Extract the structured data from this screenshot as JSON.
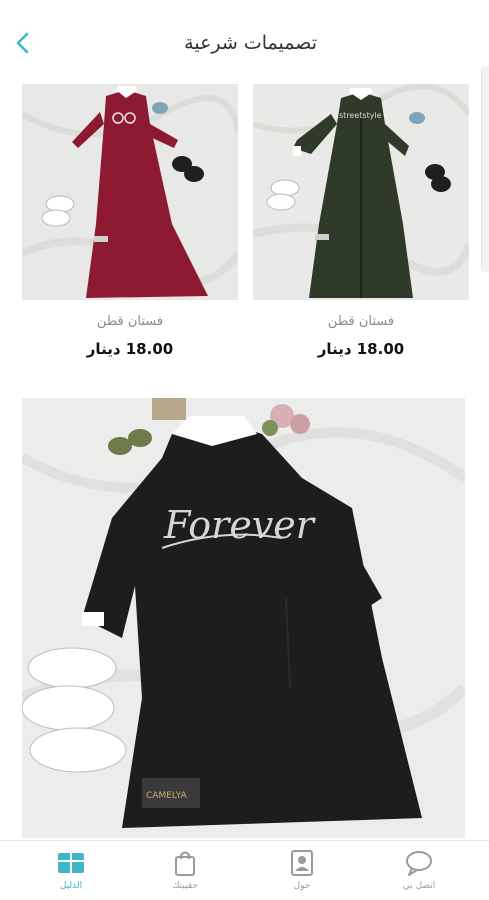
{
  "header": {
    "title": "تصميمات شرعية",
    "back_icon": "chevron-left-icon"
  },
  "products": [
    {
      "name": "فستان قطن",
      "price": "18.00 دينار",
      "color": "#2f3a28"
    },
    {
      "name": "فستان قطن",
      "price": "18.00 دينار",
      "color": "#8e1a31"
    }
  ],
  "featured": {
    "print_text": "Forever",
    "label_text": "CAMELYA",
    "color": "#1d1d1f"
  },
  "bottom_nav": [
    {
      "label": "الدليل",
      "icon": "catalog-icon",
      "active": true
    },
    {
      "label": "حقيبتك",
      "icon": "bag-icon",
      "active": false
    },
    {
      "label": "حول",
      "icon": "contact-card-icon",
      "active": false
    },
    {
      "label": "اتصل بي",
      "icon": "chat-bubble-icon",
      "active": false
    }
  ],
  "colors": {
    "accent": "#3fb6c6",
    "muted_text": "#9a9a9a"
  }
}
